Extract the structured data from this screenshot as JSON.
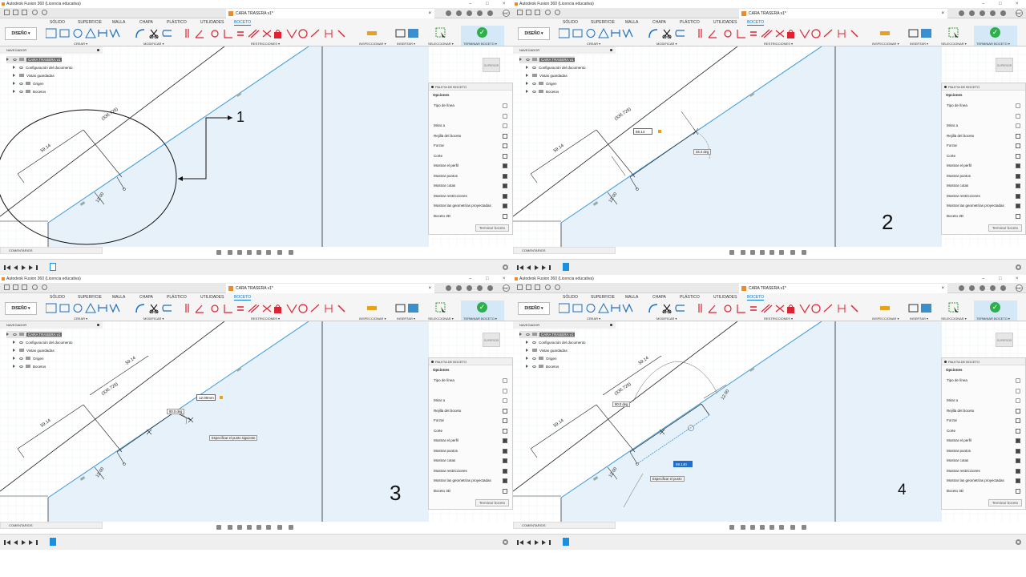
{
  "window": {
    "app_title": "Autodesk Fusion 360 (Licencia educativa)",
    "doc_title": "CARA TRASERA v1*",
    "user_initials": "MC"
  },
  "ribbon": {
    "tabs": [
      "SÓLIDO",
      "SUPERFICIE",
      "MALLA",
      "CHAPA",
      "PLÁSTICO",
      "UTILIDADES",
      "BOCETO"
    ],
    "active_tab": "BOCETO",
    "workspace": "DISEÑO ▾",
    "groups": {
      "crear": "CREAR ▾",
      "modificar": "MODIFICAR ▾",
      "restricciones": "RESTRICCIONES ▾",
      "inspeccionar": "INSPECCIONAR ▾",
      "insertar": "INSERTAR ▾",
      "seleccionar": "SELECCIONAR ▾",
      "terminar": "TERMINAR BOCETO ▾"
    }
  },
  "browser": {
    "header": "NAVEGADOR",
    "root": "CARA TRASERA v1",
    "items": [
      "Configuración del documento",
      "Vistas guardadas",
      "Origen",
      "Bocetos"
    ]
  },
  "palette": {
    "header": "PALETA DE BOCETO",
    "section": "Opciones",
    "rows": [
      {
        "label": "Tipo de línea",
        "checked": null
      },
      {
        "label": "",
        "checked": null
      },
      {
        "label": "Mirar a",
        "checked": null
      },
      {
        "label": "Rejilla del boceto",
        "checked": false
      },
      {
        "label": "Forzar",
        "checked": false
      },
      {
        "label": "Corte",
        "checked": false
      },
      {
        "label": "Mostrar el perfil",
        "checked": true
      },
      {
        "label": "Mostrar puntos",
        "checked": true
      },
      {
        "label": "Mostrar cotas",
        "checked": true
      },
      {
        "label": "Mostrar restricciones",
        "checked": true
      },
      {
        "label": "Mostrar las geometrías proyectadas",
        "checked": true
      },
      {
        "label": "Boceto 3D",
        "checked": false
      }
    ],
    "finish_button": "Terminar boceto"
  },
  "viewcube_label": "SUPERIOR",
  "comments_label": "COMENTARIOS",
  "panels": {
    "p1": {
      "dims": {
        "d1": "59.14",
        "d2": "(336.725)",
        "d3": "12.00"
      },
      "annotation_number": "1"
    },
    "p2": {
      "dims": {
        "d1": "59.14",
        "d2": "(336.725)",
        "d3": "12.00"
      },
      "edit_value": "59.14",
      "angle": "34.4 deg",
      "step": "2"
    },
    "p3": {
      "dims": {
        "d1": "59.14",
        "d2": "(336.725)",
        "d3": "12.00",
        "d4": "59.14"
      },
      "angle": "90.0 deg",
      "edit_value": "12.00mm",
      "tooltip": "Especificar el punto siguiente",
      "step": "3"
    },
    "p4": {
      "dims": {
        "d1": "59.14",
        "d2": "(336.725)",
        "d3": "12.00",
        "d4": "59.14",
        "d5": "12.00"
      },
      "angle": "90.0 deg",
      "edit_value": "59.140 mm",
      "tooltip": "Especificar el punto",
      "step": "4"
    }
  },
  "colors": {
    "accent": "#0a7bd0",
    "sketch_blue": "#3a9ad9",
    "profile_fill": "#e6f1fa",
    "finish_green": "#2db04b"
  }
}
